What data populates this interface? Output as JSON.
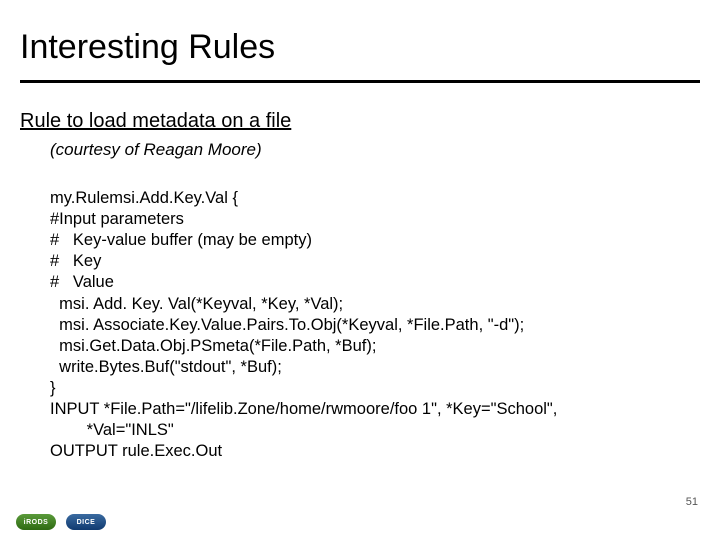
{
  "title": "Interesting Rules",
  "subtitle": "Rule to load metadata on a file",
  "courtesy": "(courtesy of Reagan Moore)",
  "code": "my.Rulemsi.Add.Key.Val {\n#Input parameters\n#   Key-value buffer (may be empty)\n#   Key\n#   Value\n  msi. Add. Key. Val(*Keyval, *Key, *Val);\n  msi. Associate.Key.Value.Pairs.To.Obj(*Keyval, *File.Path, \"-d\");\n  msi.Get.Data.Obj.PSmeta(*File.Path, *Buf);\n  write.Bytes.Buf(\"stdout\", *Buf);\n}\nINPUT *File.Path=\"/lifelib.Zone/home/rwmoore/foo 1\", *Key=\"School\",\n        *Val=\"INLS\"\nOUTPUT rule.Exec.Out",
  "page_number": "51",
  "logos": {
    "irods": "iRODS",
    "dice": "DICE"
  }
}
